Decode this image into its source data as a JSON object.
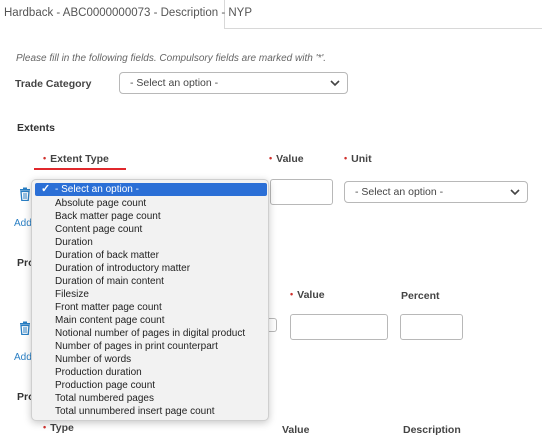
{
  "tab": {
    "label": "Hardback - ABC0000000073 - Description - NYP"
  },
  "instructions": "Please fill in the following fields. Compulsory fields are marked with '*'.",
  "trade_category": {
    "label": "Trade Category",
    "value": "- Select an option -"
  },
  "extents": {
    "title": "Extents",
    "extent_type_label": "Extent Type",
    "value_label": "Value",
    "unit_label": "Unit",
    "unit_value": "- Select an option -",
    "add_label": "Add"
  },
  "dropdown": {
    "selected": "- Select an option -",
    "options": [
      "Absolute page count",
      "Back matter page count",
      "Content page count",
      "Duration",
      "Duration of back matter",
      "Duration of introductory matter",
      "Duration of main content",
      "Filesize",
      "Front matter page count",
      "Main content page count",
      "Notional number of pages in digital product",
      "Number of pages in print counterpart",
      "Number of words",
      "Production duration",
      "Production page count",
      "Total numbered pages",
      "Total unnumbered insert page count"
    ]
  },
  "section2": {
    "partial_title": "Pro",
    "value_label": "Value",
    "percent_label": "Percent",
    "add_label": "Add"
  },
  "section3": {
    "partial_title": "Pro",
    "type_label": "Type",
    "value_label": "Value",
    "description_label": "Description"
  },
  "colors": {
    "required": "#d0312d",
    "accent_underline": "#e0282c",
    "selection": "#2b6fd6",
    "link": "#2a7fc4"
  }
}
